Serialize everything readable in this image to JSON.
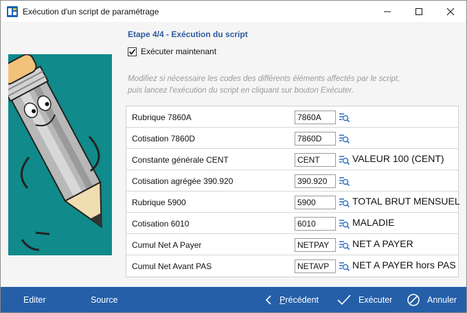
{
  "window": {
    "title": "Exécution d'un script de paramétrage",
    "icons": {
      "app": "app-icon",
      "minimize": "minimize-icon",
      "maximize": "maximize-icon",
      "close": "close-icon"
    }
  },
  "step": {
    "title": "Etape 4/4 - Exécution du script",
    "checkbox_label": "Exécuter maintenant",
    "checkbox_checked": true,
    "hint_line1": "Modifiez si nécessaire les codes des différents éléments affectés par le script,",
    "hint_line2": "puis lancez l'exécution du script en cliquant sur bouton Exécuter."
  },
  "rows": [
    {
      "label": "Rubrique 7860A",
      "code": "7860A",
      "desc": ""
    },
    {
      "label": "Cotisation 7860D",
      "code": "7860D",
      "desc": ""
    },
    {
      "label": "Constante générale CENT",
      "code": "CENT",
      "desc": "VALEUR 100 (CENT)"
    },
    {
      "label": "Cotisation agrégée 390.920",
      "code": "390.920",
      "desc": ""
    },
    {
      "label": "Rubrique 5900",
      "code": "5900",
      "desc": "TOTAL BRUT MENSUEL"
    },
    {
      "label": "Cotisation 6010",
      "code": "6010",
      "desc": "MALADIE"
    },
    {
      "label": "Cumul Net A Payer",
      "code": "NETPAY",
      "desc": "NET A PAYER"
    },
    {
      "label": "Cumul Net Avant PAS",
      "code": "NETAVP",
      "desc": "NET A PAYER hors PAS"
    }
  ],
  "footer": {
    "edit_label": "Editer",
    "source_label": "Source",
    "prev_label_first": "P",
    "prev_label_rest": "récédent",
    "exec_label": "Exécuter",
    "cancel_label": "Annuler"
  },
  "colors": {
    "accent": "#245fa8",
    "title_blue": "#2e5a9e",
    "picture_bg": "#108a8a"
  }
}
